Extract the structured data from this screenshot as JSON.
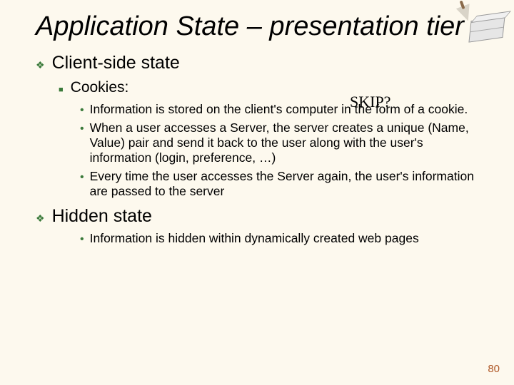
{
  "title": "Application State – presentation tier",
  "skip_label": "SKIP?",
  "page_number": "80",
  "sections": [
    {
      "heading": "Client-side state",
      "sub": {
        "heading": "Cookies:",
        "bullets": [
          "Information is stored on the client's computer in the form of a cookie.",
          "When a user accesses a Server, the server creates a unique (Name, Value) pair and send it back to the user along with the user's information (login, preference, …)",
          "Every time the user accesses the Server again, the user's information are passed to the server"
        ]
      }
    },
    {
      "heading": "Hidden state",
      "bullets": [
        "Information is hidden within dynamically created web pages"
      ]
    }
  ]
}
